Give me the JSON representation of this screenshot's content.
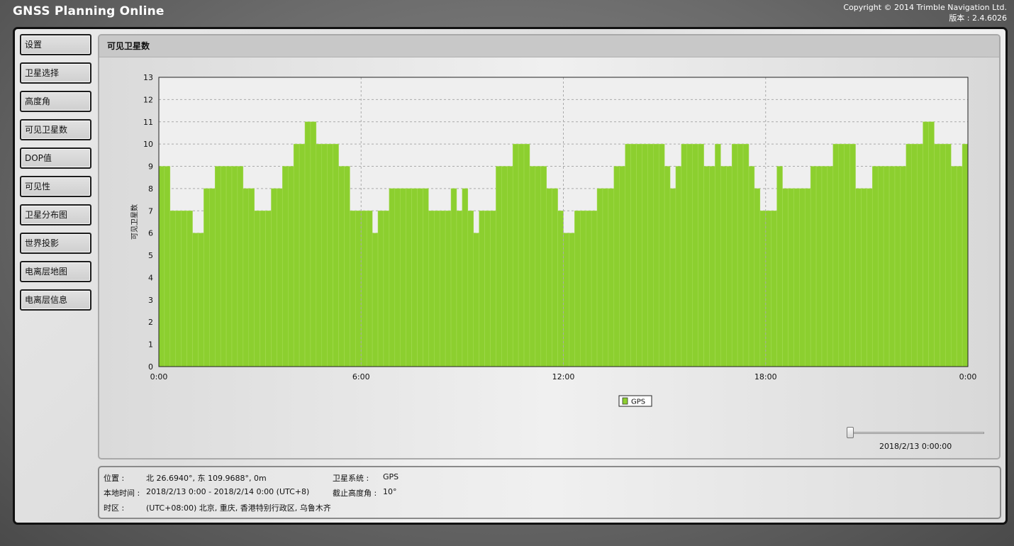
{
  "app": {
    "title": "GNSS Planning Online",
    "copyright": "Copyright © 2014 Trimble Navigation Ltd.",
    "version": "版本 : 2.4.6026"
  },
  "sidebar": {
    "items": [
      {
        "label": "设置"
      },
      {
        "label": "卫星选择"
      },
      {
        "label": "高度角"
      },
      {
        "label": "可见卫星数"
      },
      {
        "label": "DOP值"
      },
      {
        "label": "可见性"
      },
      {
        "label": "卫星分布图"
      },
      {
        "label": "世界投影"
      },
      {
        "label": "电离层地图"
      },
      {
        "label": "电离层信息"
      }
    ]
  },
  "panel": {
    "title": "可见卫星数"
  },
  "colors": {
    "bar_fill": "#8ccf2f",
    "plot_bg": "#efefef",
    "grid": "#aaaaaa"
  },
  "chart_data": {
    "type": "bar",
    "title": "",
    "ylabel": "可见卫星数",
    "xlabel": "",
    "ylim": [
      0,
      13
    ],
    "yticks": [
      0,
      1,
      2,
      3,
      4,
      5,
      6,
      7,
      8,
      9,
      10,
      11,
      12,
      13
    ],
    "xlim_hours": [
      0,
      24
    ],
    "xticks": [
      {
        "hour": 0,
        "label": "0:00"
      },
      {
        "hour": 6,
        "label": "6:00"
      },
      {
        "hour": 12,
        "label": "12:00"
      },
      {
        "hour": 18,
        "label": "18:00"
      },
      {
        "hour": 24,
        "label": "0:00"
      }
    ],
    "grid": true,
    "legend": "bottom-center",
    "series": [
      {
        "name": "GPS",
        "color": "#8ccf2f",
        "segments": [
          {
            "start": "0:00",
            "end": "0:10",
            "value": 9
          },
          {
            "start": "0:10",
            "end": "0:20",
            "value": 9
          },
          {
            "start": "0:20",
            "end": "0:40",
            "value": 7
          },
          {
            "start": "0:40",
            "end": "1:00",
            "value": 7
          },
          {
            "start": "1:00",
            "end": "1:20",
            "value": 6
          },
          {
            "start": "1:20",
            "end": "1:40",
            "value": 8
          },
          {
            "start": "1:40",
            "end": "2:30",
            "value": 9
          },
          {
            "start": "2:30",
            "end": "2:50",
            "value": 8
          },
          {
            "start": "2:50",
            "end": "3:20",
            "value": 7
          },
          {
            "start": "3:20",
            "end": "3:40",
            "value": 8
          },
          {
            "start": "3:40",
            "end": "4:00",
            "value": 9
          },
          {
            "start": "4:00",
            "end": "4:20",
            "value": 10
          },
          {
            "start": "4:20",
            "end": "4:40",
            "value": 11
          },
          {
            "start": "4:40",
            "end": "5:20",
            "value": 10
          },
          {
            "start": "5:20",
            "end": "5:40",
            "value": 9
          },
          {
            "start": "5:40",
            "end": "6:20",
            "value": 7
          },
          {
            "start": "6:20",
            "end": "6:30",
            "value": 6
          },
          {
            "start": "6:30",
            "end": "6:50",
            "value": 7
          },
          {
            "start": "6:50",
            "end": "7:20",
            "value": 8
          },
          {
            "start": "7:20",
            "end": "8:00",
            "value": 8
          },
          {
            "start": "8:00",
            "end": "8:40",
            "value": 7
          },
          {
            "start": "8:40",
            "end": "8:50",
            "value": 8
          },
          {
            "start": "8:50",
            "end": "9:00",
            "value": 7
          },
          {
            "start": "9:00",
            "end": "9:10",
            "value": 8
          },
          {
            "start": "9:10",
            "end": "9:20",
            "value": 7
          },
          {
            "start": "9:20",
            "end": "9:30",
            "value": 6
          },
          {
            "start": "9:30",
            "end": "10:00",
            "value": 7
          },
          {
            "start": "10:00",
            "end": "10:30",
            "value": 9
          },
          {
            "start": "10:30",
            "end": "11:00",
            "value": 10
          },
          {
            "start": "11:00",
            "end": "11:30",
            "value": 9
          },
          {
            "start": "11:30",
            "end": "11:50",
            "value": 8
          },
          {
            "start": "11:50",
            "end": "12:00",
            "value": 7
          },
          {
            "start": "12:00",
            "end": "12:20",
            "value": 6
          },
          {
            "start": "12:20",
            "end": "13:00",
            "value": 7
          },
          {
            "start": "13:00",
            "end": "13:30",
            "value": 8
          },
          {
            "start": "13:30",
            "end": "13:50",
            "value": 9
          },
          {
            "start": "13:50",
            "end": "15:00",
            "value": 10
          },
          {
            "start": "15:00",
            "end": "15:10",
            "value": 9
          },
          {
            "start": "15:10",
            "end": "15:20",
            "value": 8
          },
          {
            "start": "15:20",
            "end": "15:30",
            "value": 9
          },
          {
            "start": "15:30",
            "end": "16:10",
            "value": 10
          },
          {
            "start": "16:10",
            "end": "16:30",
            "value": 9
          },
          {
            "start": "16:30",
            "end": "16:40",
            "value": 10
          },
          {
            "start": "16:40",
            "end": "17:00",
            "value": 9
          },
          {
            "start": "17:00",
            "end": "17:30",
            "value": 10
          },
          {
            "start": "17:30",
            "end": "17:40",
            "value": 9
          },
          {
            "start": "17:40",
            "end": "17:50",
            "value": 8
          },
          {
            "start": "17:50",
            "end": "18:20",
            "value": 7
          },
          {
            "start": "18:20",
            "end": "18:30",
            "value": 9
          },
          {
            "start": "18:30",
            "end": "19:20",
            "value": 8
          },
          {
            "start": "19:20",
            "end": "20:00",
            "value": 9
          },
          {
            "start": "20:00",
            "end": "20:40",
            "value": 10
          },
          {
            "start": "20:40",
            "end": "21:10",
            "value": 8
          },
          {
            "start": "21:10",
            "end": "22:10",
            "value": 9
          },
          {
            "start": "22:10",
            "end": "22:40",
            "value": 10
          },
          {
            "start": "22:40",
            "end": "23:00",
            "value": 11
          },
          {
            "start": "23:00",
            "end": "23:30",
            "value": 10
          },
          {
            "start": "23:30",
            "end": "23:50",
            "value": 9
          },
          {
            "start": "23:50",
            "end": "24:00",
            "value": 10
          }
        ]
      }
    ]
  },
  "slider": {
    "value_label": "2018/2/13 0:00:00",
    "position": 0
  },
  "info": {
    "position_label": "位置 :",
    "position_value": "北 26.6940°, 东 109.9688°, 0m",
    "localtime_label": "本地时间 :",
    "localtime_value": "2018/2/13 0:00 - 2018/2/14 0:00 (UTC+8)",
    "timezone_label": "时区 :",
    "timezone_value": "(UTC+08:00) 北京, 重庆, 香港特别行政区, 乌鲁木齐",
    "system_label": "卫星系统 :",
    "system_value": "GPS",
    "cutoff_label": "截止高度角 :",
    "cutoff_value": "10°"
  }
}
